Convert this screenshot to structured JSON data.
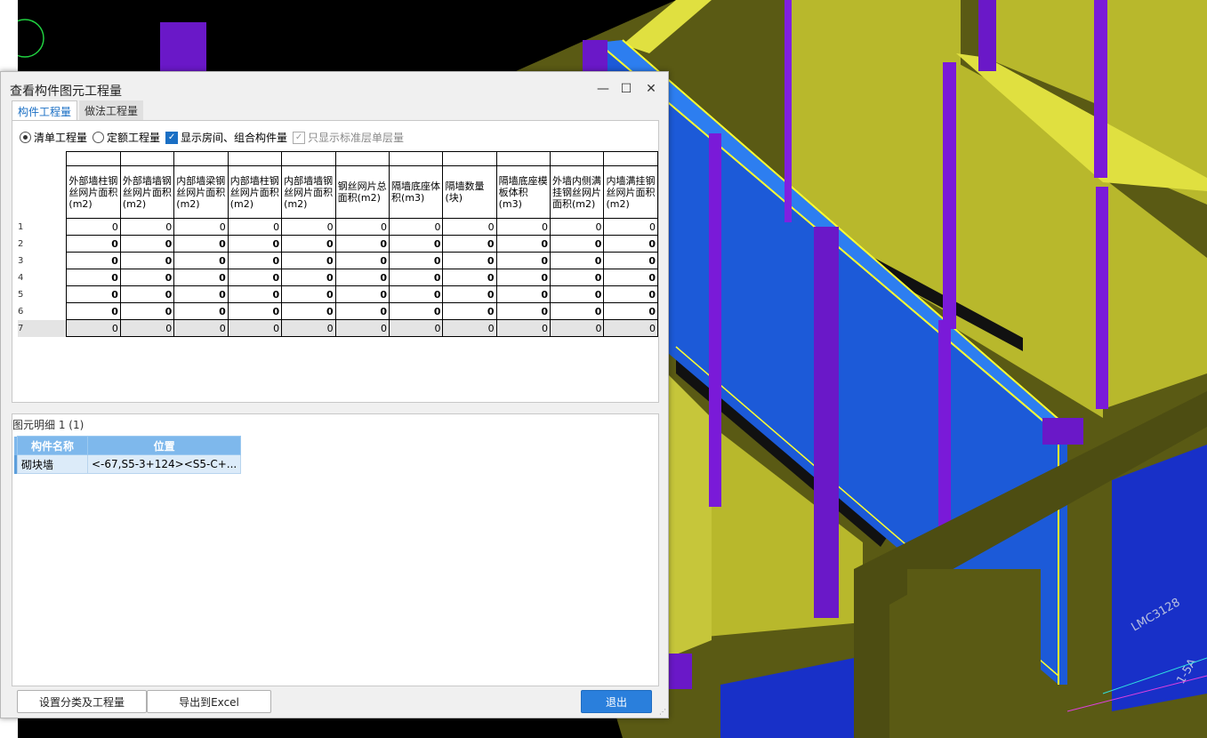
{
  "dialog": {
    "title": "查看构件图元工程量",
    "window_controls": [
      "minimize-icon",
      "maximize-icon",
      "close-icon"
    ],
    "tabs": [
      {
        "label": "构件工程量",
        "active": true
      },
      {
        "label": "做法工程量",
        "active": false
      }
    ],
    "options": {
      "radio_list": "清单工程量",
      "radio_quota": "定额工程量",
      "check_rooms": "显示房间、组合构件量",
      "check_standard": "只显示标准层单层量"
    },
    "table": {
      "columns": [
        "外部墙柱钢丝网片面积(m2)",
        "外部墙墙钢丝网片面积(m2)",
        "内部墙梁钢丝网片面积(m2)",
        "内部墙柱钢丝网片面积(m2)",
        "内部墙墙钢丝网片面积(m2)",
        "钢丝网片总面积(m2)",
        "隔墙底座体积(m3)",
        "隔墙数量(块)",
        "隔墙底座模板体积(m3)",
        "外墙内侧满挂钢丝网片面积(m2)",
        "内墙满挂钢丝网片面积(m2)"
      ],
      "rows": [
        {
          "n": "1",
          "v": [
            "0",
            "0",
            "0",
            "0",
            "0",
            "0",
            "0",
            "0",
            "0",
            "0",
            "0"
          ]
        },
        {
          "n": "2",
          "v": [
            "0",
            "0",
            "0",
            "0",
            "0",
            "0",
            "0",
            "0",
            "0",
            "0",
            "0"
          ]
        },
        {
          "n": "3",
          "v": [
            "0",
            "0",
            "0",
            "0",
            "0",
            "0",
            "0",
            "0",
            "0",
            "0",
            "0"
          ]
        },
        {
          "n": "4",
          "v": [
            "0",
            "0",
            "0",
            "0",
            "0",
            "0",
            "0",
            "0",
            "0",
            "0",
            "0"
          ]
        },
        {
          "n": "5",
          "v": [
            "0",
            "0",
            "0",
            "0",
            "0",
            "0",
            "0",
            "0",
            "0",
            "0",
            "0"
          ]
        },
        {
          "n": "6",
          "v": [
            "0",
            "0",
            "0",
            "0",
            "0",
            "0",
            "0",
            "0",
            "0",
            "0",
            "0"
          ]
        },
        {
          "n": "7",
          "v": [
            "0",
            "0",
            "0",
            "0",
            "0",
            "0",
            "0",
            "0",
            "0",
            "0",
            "0"
          ]
        }
      ]
    },
    "detail": {
      "title": "图元明细  1 (1)",
      "headers": [
        "构件名称",
        "位置"
      ],
      "rows": [
        [
          "砌块墙",
          "<-67,S5-3+124><S5-C+..."
        ]
      ]
    },
    "buttons": {
      "settings": "设置分类及工程量",
      "export": "导出到Excel",
      "exit": "退出"
    }
  },
  "viewport_labels": [
    "LMC3128",
    "1-5A"
  ],
  "colors": {
    "accent": "#2a7fdc",
    "wall_yellow": "#b8b830",
    "wall_blue": "#1c5ad8",
    "column_purple": "#6a18c8"
  }
}
